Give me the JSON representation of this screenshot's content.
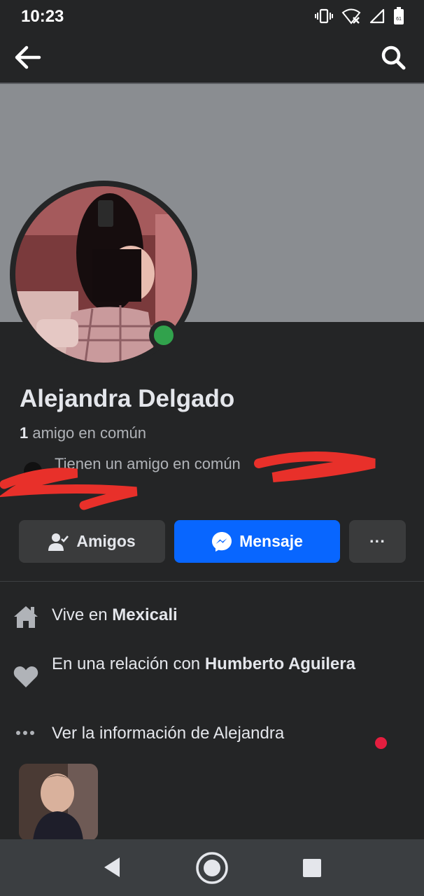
{
  "status_bar": {
    "time": "10:23",
    "battery_percent": "61"
  },
  "profile": {
    "name": "Alejandra Delgado",
    "mutual_count": "1",
    "mutual_text": "amigo en común",
    "mutual_detail": "Tienen un amigo en común"
  },
  "actions": {
    "friends_label": "Amigos",
    "message_label": "Mensaje",
    "more_label": "···"
  },
  "info": {
    "lives_prefix": "Vive en",
    "lives_city": "Mexicali",
    "relationship_prefix": "En una relación con",
    "relationship_name": "Humberto Aguilera",
    "see_info": "Ver la información de Alejandra"
  },
  "colors": {
    "background": "#242526",
    "cover": "#8a8d91",
    "button_secondary": "#3a3b3c",
    "messenger_blue": "#0866ff",
    "online": "#31a24c",
    "notification": "#e41e3f",
    "redaction": "#e8302a"
  },
  "icons": {
    "back": "arrow-left-icon",
    "search": "search-icon",
    "friends": "user-check-icon",
    "message": "messenger-icon",
    "more": "more-horizontal-icon",
    "home": "home-icon",
    "heart": "heart-icon",
    "ellipsis": "ellipsis-icon"
  }
}
